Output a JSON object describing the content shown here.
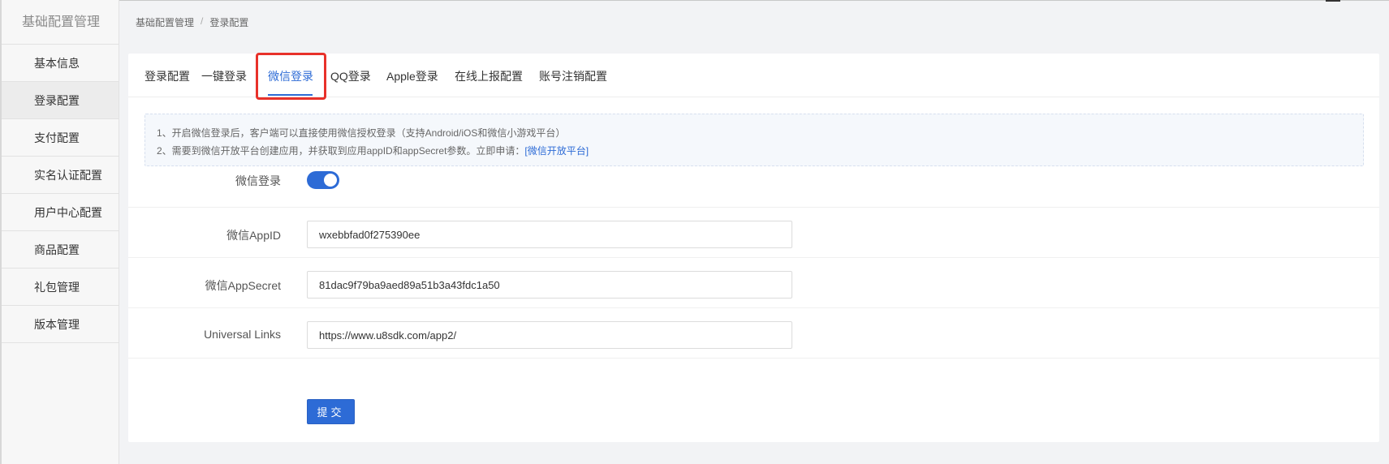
{
  "sidebar": {
    "title": "基础配置管理",
    "items": [
      {
        "label": "基本信息"
      },
      {
        "label": "登录配置"
      },
      {
        "label": "支付配置"
      },
      {
        "label": "实名认证配置"
      },
      {
        "label": "用户中心配置"
      },
      {
        "label": "商品配置"
      },
      {
        "label": "礼包管理"
      },
      {
        "label": "版本管理"
      }
    ],
    "active_index": 1
  },
  "breadcrumb": {
    "root": "基础配置管理",
    "separator": "/",
    "current": "登录配置"
  },
  "tabs": [
    {
      "label": "登录配置"
    },
    {
      "label": "一键登录"
    },
    {
      "label": "微信登录"
    },
    {
      "label": "QQ登录"
    },
    {
      "label": "Apple登录"
    },
    {
      "label": "在线上报配置"
    },
    {
      "label": "账号注销配置"
    }
  ],
  "active_tab": "微信登录",
  "notice": {
    "line1": "1、开启微信登录后，客户端可以直接使用微信授权登录（支持Android/iOS和微信小游戏平台）",
    "line2_prefix": "2、需要到微信开放平台创建应用，并获取到应用appID和appSecret参数。立即申请：",
    "line2_link": "[微信开放平台]"
  },
  "form": {
    "wechat_login_label": "微信登录",
    "wechat_login_enabled": true,
    "appid_label": "微信AppID",
    "appid_value": "wxebbfad0f275390ee",
    "appsecret_label": "微信AppSecret",
    "appsecret_value": "81dac9f79ba9aed89a51b3a43fdc1a50",
    "universal_links_label": "Universal Links",
    "universal_links_value": "https://www.u8sdk.com/app2/",
    "submit_label": "提交"
  },
  "colors": {
    "accent": "#2d6bd6",
    "highlight": "#e8312a"
  }
}
